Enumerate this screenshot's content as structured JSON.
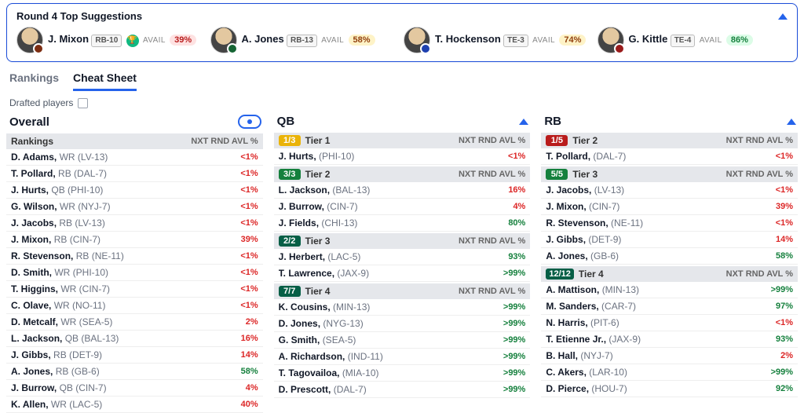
{
  "colors": {
    "accent": "#2563eb",
    "red_pill_bg": "#fee2e2",
    "yellow_pill_bg": "#fef3c7",
    "green_pill_bg": "#dcfce7"
  },
  "suggestions": {
    "title": "Round 4 Top Suggestions",
    "avail_label": "AVAIL",
    "items": [
      {
        "name": "J. Mixon",
        "pos": "RB-10",
        "pct": "39%",
        "pct_cls": "pct-red",
        "team_color": "#7c2d12",
        "trophy": true
      },
      {
        "name": "A. Jones",
        "pos": "RB-13",
        "pct": "58%",
        "pct_cls": "pct-yel",
        "team_color": "#166534",
        "trophy": false
      },
      {
        "name": "T. Hockenson",
        "pos": "TE-3",
        "pct": "74%",
        "pct_cls": "pct-yel",
        "team_color": "#1e40af",
        "trophy": false
      },
      {
        "name": "G. Kittle",
        "pos": "TE-4",
        "pct": "86%",
        "pct_cls": "pct-grn",
        "team_color": "#991b1b",
        "trophy": false
      }
    ]
  },
  "tabs": {
    "rankings": "Rankings",
    "cheat": "Cheat Sheet"
  },
  "drafted_label": "Drafted players",
  "col_header_sub": "NXT RND AVL %",
  "columns": [
    {
      "title": "Overall",
      "icon": "eye",
      "sections": [
        {
          "badge": null,
          "title": "Rankings",
          "rows": [
            {
              "name": "D. Adams,",
              "meta": "WR (LV-13)",
              "pct": "<1%",
              "pc": "r"
            },
            {
              "name": "T. Pollard,",
              "meta": "RB (DAL-7)",
              "pct": "<1%",
              "pc": "r"
            },
            {
              "name": "J. Hurts,",
              "meta": "QB (PHI-10)",
              "pct": "<1%",
              "pc": "r"
            },
            {
              "name": "G. Wilson,",
              "meta": "WR (NYJ-7)",
              "pct": "<1%",
              "pc": "r"
            },
            {
              "name": "J. Jacobs,",
              "meta": "RB (LV-13)",
              "pct": "<1%",
              "pc": "r"
            },
            {
              "name": "J. Mixon,",
              "meta": "RB (CIN-7)",
              "pct": "39%",
              "pc": "r"
            },
            {
              "name": "R. Stevenson,",
              "meta": "RB (NE-11)",
              "pct": "<1%",
              "pc": "r"
            },
            {
              "name": "D. Smith,",
              "meta": "WR (PHI-10)",
              "pct": "<1%",
              "pc": "r"
            },
            {
              "name": "T. Higgins,",
              "meta": "WR (CIN-7)",
              "pct": "<1%",
              "pc": "r"
            },
            {
              "name": "C. Olave,",
              "meta": "WR (NO-11)",
              "pct": "<1%",
              "pc": "r"
            },
            {
              "name": "D. Metcalf,",
              "meta": "WR (SEA-5)",
              "pct": "2%",
              "pc": "r"
            },
            {
              "name": "L. Jackson,",
              "meta": "QB (BAL-13)",
              "pct": "16%",
              "pc": "r"
            },
            {
              "name": "J. Gibbs,",
              "meta": "RB (DET-9)",
              "pct": "14%",
              "pc": "r"
            },
            {
              "name": "A. Jones,",
              "meta": "RB (GB-6)",
              "pct": "58%",
              "pc": "g"
            },
            {
              "name": "J. Burrow,",
              "meta": "QB (CIN-7)",
              "pct": "4%",
              "pc": "r"
            },
            {
              "name": "K. Allen,",
              "meta": "WR (LAC-5)",
              "pct": "40%",
              "pc": "r"
            }
          ]
        }
      ]
    },
    {
      "title": "QB",
      "icon": "chev",
      "sections": [
        {
          "badge": "1/3",
          "badge_cls": "tb-yel",
          "title": "Tier 1",
          "rows": [
            {
              "name": "J. Hurts,",
              "meta": "(PHI-10)",
              "pct": "<1%",
              "pc": "r"
            }
          ]
        },
        {
          "badge": "3/3",
          "badge_cls": "tb-grn",
          "title": "Tier 2",
          "rows": [
            {
              "name": "L. Jackson,",
              "meta": "(BAL-13)",
              "pct": "16%",
              "pc": "r"
            },
            {
              "name": "J. Burrow,",
              "meta": "(CIN-7)",
              "pct": "4%",
              "pc": "r"
            },
            {
              "name": "J. Fields,",
              "meta": "(CHI-13)",
              "pct": "80%",
              "pc": "g"
            }
          ]
        },
        {
          "badge": "2/2",
          "badge_cls": "tb-dg",
          "title": "Tier 3",
          "rows": [
            {
              "name": "J. Herbert,",
              "meta": "(LAC-5)",
              "pct": "93%",
              "pc": "g"
            },
            {
              "name": "T. Lawrence,",
              "meta": "(JAX-9)",
              "pct": ">99%",
              "pc": "g"
            }
          ]
        },
        {
          "badge": "7/7",
          "badge_cls": "tb-dg",
          "title": "Tier 4",
          "rows": [
            {
              "name": "K. Cousins,",
              "meta": "(MIN-13)",
              "pct": ">99%",
              "pc": "g"
            },
            {
              "name": "D. Jones,",
              "meta": "(NYG-13)",
              "pct": ">99%",
              "pc": "g"
            },
            {
              "name": "G. Smith,",
              "meta": "(SEA-5)",
              "pct": ">99%",
              "pc": "g"
            },
            {
              "name": "A. Richardson,",
              "meta": "(IND-11)",
              "pct": ">99%",
              "pc": "g"
            },
            {
              "name": "T. Tagovailoa,",
              "meta": "(MIA-10)",
              "pct": ">99%",
              "pc": "g"
            },
            {
              "name": "D. Prescott,",
              "meta": "(DAL-7)",
              "pct": ">99%",
              "pc": "g"
            }
          ]
        }
      ]
    },
    {
      "title": "RB",
      "icon": "chev",
      "sections": [
        {
          "badge": "1/5",
          "badge_cls": "tb-red",
          "title": "Tier 2",
          "rows": [
            {
              "name": "T. Pollard,",
              "meta": "(DAL-7)",
              "pct": "<1%",
              "pc": "r"
            }
          ]
        },
        {
          "badge": "5/5",
          "badge_cls": "tb-grn",
          "title": "Tier 3",
          "rows": [
            {
              "name": "J. Jacobs,",
              "meta": "(LV-13)",
              "pct": "<1%",
              "pc": "r"
            },
            {
              "name": "J. Mixon,",
              "meta": "(CIN-7)",
              "pct": "39%",
              "pc": "r"
            },
            {
              "name": "R. Stevenson,",
              "meta": "(NE-11)",
              "pct": "<1%",
              "pc": "r"
            },
            {
              "name": "J. Gibbs,",
              "meta": "(DET-9)",
              "pct": "14%",
              "pc": "r"
            },
            {
              "name": "A. Jones,",
              "meta": "(GB-6)",
              "pct": "58%",
              "pc": "g"
            }
          ]
        },
        {
          "badge": "12/12",
          "badge_cls": "tb-dg",
          "title": "Tier 4",
          "rows": [
            {
              "name": "A. Mattison,",
              "meta": "(MIN-13)",
              "pct": ">99%",
              "pc": "g"
            },
            {
              "name": "M. Sanders,",
              "meta": "(CAR-7)",
              "pct": "97%",
              "pc": "g"
            },
            {
              "name": "N. Harris,",
              "meta": "(PIT-6)",
              "pct": "<1%",
              "pc": "r"
            },
            {
              "name": "T. Etienne Jr.,",
              "meta": "(JAX-9)",
              "pct": "93%",
              "pc": "g"
            },
            {
              "name": "B. Hall,",
              "meta": "(NYJ-7)",
              "pct": "2%",
              "pc": "r"
            },
            {
              "name": "C. Akers,",
              "meta": "(LAR-10)",
              "pct": ">99%",
              "pc": "g"
            },
            {
              "name": "D. Pierce,",
              "meta": "(HOU-7)",
              "pct": "92%",
              "pc": "g"
            }
          ]
        }
      ]
    }
  ]
}
